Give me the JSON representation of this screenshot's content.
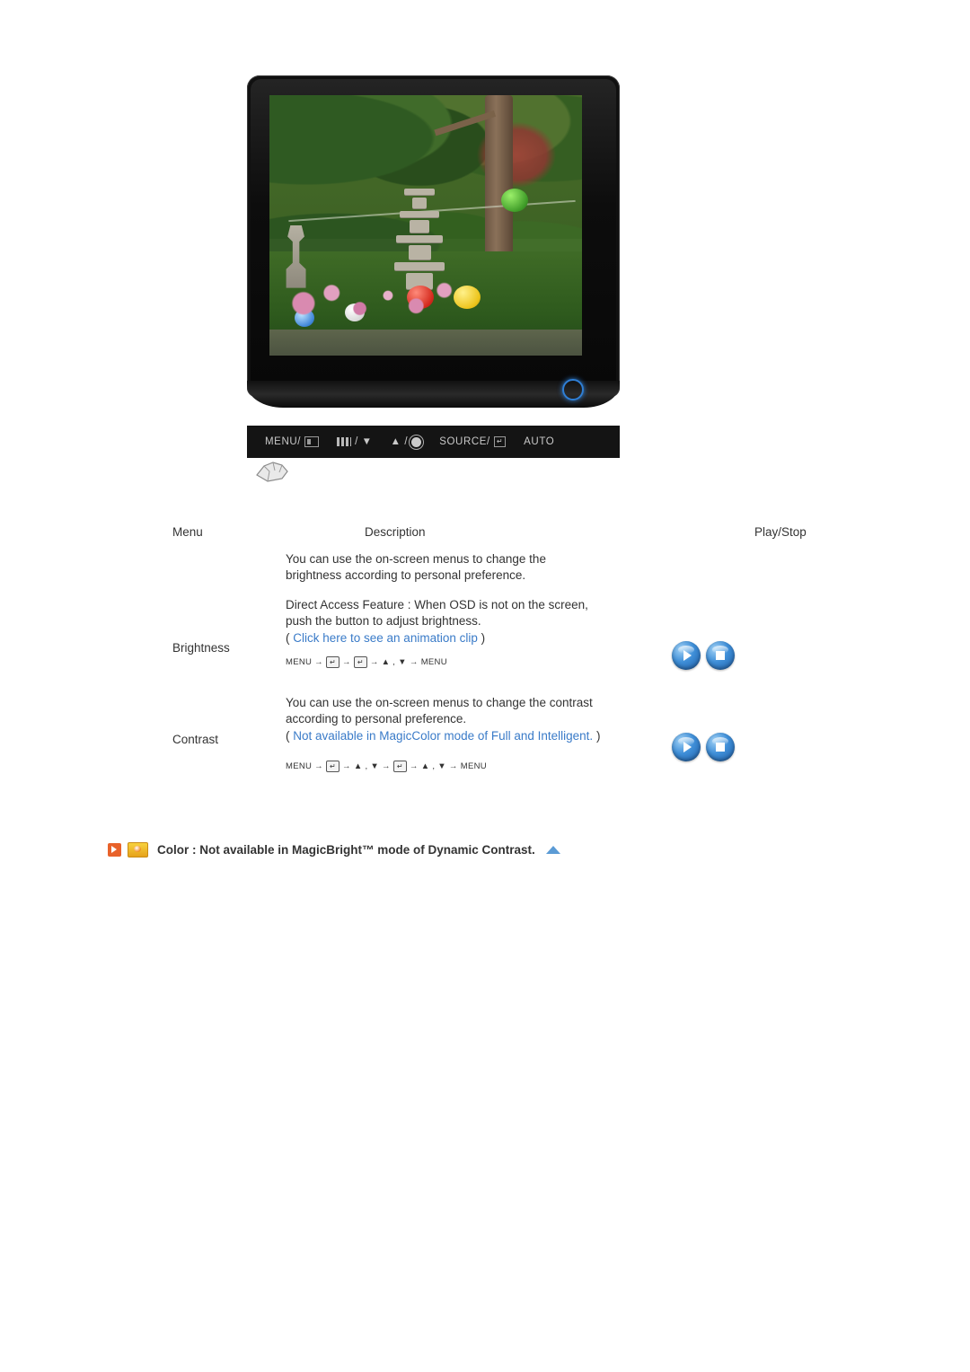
{
  "monitor": {
    "controls": [
      {
        "name": "menu-button",
        "label": "MENU/",
        "glyph": "box"
      },
      {
        "name": "down-button",
        "label": "/ ▼",
        "glyph": "magicbright"
      },
      {
        "name": "up-button",
        "label": "▲ /",
        "glyph": "brightness"
      },
      {
        "name": "source-button",
        "label": "SOURCE/",
        "glyph": "enter"
      },
      {
        "name": "auto-button",
        "label": "AUTO",
        "glyph": "none"
      }
    ]
  },
  "table": {
    "headers": {
      "menu": "Menu",
      "description": "Description",
      "play_stop": "Play/Stop"
    },
    "rows": [
      {
        "menu": "Brightness",
        "lines": [
          "You can use the on-screen menus to change the",
          "brightness according to personal preference.",
          "Direct Access Feature : When OSD is not on the screen,",
          "push the button to adjust brightness."
        ],
        "note_prefix": "( ",
        "note": "Click here to see an animation clip",
        "note_suffix": " )",
        "note_color": "#3a7bc8",
        "path": [
          "MENU",
          "→",
          "ENTER",
          "→",
          "ENTER",
          "→",
          "▲ , ▼",
          "→",
          "MENU"
        ]
      },
      {
        "menu": "Contrast",
        "lines": [
          "You can use the on-screen menus to change the contrast",
          "according to personal preference."
        ],
        "note_prefix": "( ",
        "note": "Not available in MagicColor mode of Full and Intelligent.",
        "note_suffix": " )",
        "note_color": "#3a7bc8",
        "path": [
          "MENU",
          "→",
          "ENTER",
          "→",
          "▲ , ▼",
          "→",
          "ENTER",
          "→",
          "▲ , ▼",
          "→",
          "MENU"
        ]
      }
    ],
    "buttons": {
      "play": "Play",
      "stop": "Stop"
    }
  },
  "footer": {
    "color_note": "Color : Not available in MagicBright™ mode of Dynamic Contrast."
  }
}
